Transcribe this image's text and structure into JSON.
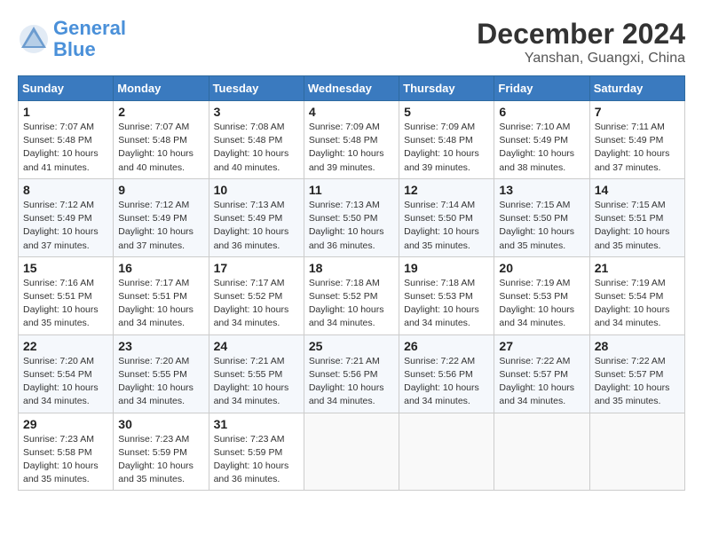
{
  "header": {
    "logo_line1": "General",
    "logo_line2": "Blue",
    "month": "December 2024",
    "location": "Yanshan, Guangxi, China"
  },
  "weekdays": [
    "Sunday",
    "Monday",
    "Tuesday",
    "Wednesday",
    "Thursday",
    "Friday",
    "Saturday"
  ],
  "weeks": [
    [
      {
        "day": "1",
        "info": "Sunrise: 7:07 AM\nSunset: 5:48 PM\nDaylight: 10 hours\nand 41 minutes."
      },
      {
        "day": "2",
        "info": "Sunrise: 7:07 AM\nSunset: 5:48 PM\nDaylight: 10 hours\nand 40 minutes."
      },
      {
        "day": "3",
        "info": "Sunrise: 7:08 AM\nSunset: 5:48 PM\nDaylight: 10 hours\nand 40 minutes."
      },
      {
        "day": "4",
        "info": "Sunrise: 7:09 AM\nSunset: 5:48 PM\nDaylight: 10 hours\nand 39 minutes."
      },
      {
        "day": "5",
        "info": "Sunrise: 7:09 AM\nSunset: 5:48 PM\nDaylight: 10 hours\nand 39 minutes."
      },
      {
        "day": "6",
        "info": "Sunrise: 7:10 AM\nSunset: 5:49 PM\nDaylight: 10 hours\nand 38 minutes."
      },
      {
        "day": "7",
        "info": "Sunrise: 7:11 AM\nSunset: 5:49 PM\nDaylight: 10 hours\nand 37 minutes."
      }
    ],
    [
      {
        "day": "8",
        "info": "Sunrise: 7:12 AM\nSunset: 5:49 PM\nDaylight: 10 hours\nand 37 minutes."
      },
      {
        "day": "9",
        "info": "Sunrise: 7:12 AM\nSunset: 5:49 PM\nDaylight: 10 hours\nand 37 minutes."
      },
      {
        "day": "10",
        "info": "Sunrise: 7:13 AM\nSunset: 5:49 PM\nDaylight: 10 hours\nand 36 minutes."
      },
      {
        "day": "11",
        "info": "Sunrise: 7:13 AM\nSunset: 5:50 PM\nDaylight: 10 hours\nand 36 minutes."
      },
      {
        "day": "12",
        "info": "Sunrise: 7:14 AM\nSunset: 5:50 PM\nDaylight: 10 hours\nand 35 minutes."
      },
      {
        "day": "13",
        "info": "Sunrise: 7:15 AM\nSunset: 5:50 PM\nDaylight: 10 hours\nand 35 minutes."
      },
      {
        "day": "14",
        "info": "Sunrise: 7:15 AM\nSunset: 5:51 PM\nDaylight: 10 hours\nand 35 minutes."
      }
    ],
    [
      {
        "day": "15",
        "info": "Sunrise: 7:16 AM\nSunset: 5:51 PM\nDaylight: 10 hours\nand 35 minutes."
      },
      {
        "day": "16",
        "info": "Sunrise: 7:17 AM\nSunset: 5:51 PM\nDaylight: 10 hours\nand 34 minutes."
      },
      {
        "day": "17",
        "info": "Sunrise: 7:17 AM\nSunset: 5:52 PM\nDaylight: 10 hours\nand 34 minutes."
      },
      {
        "day": "18",
        "info": "Sunrise: 7:18 AM\nSunset: 5:52 PM\nDaylight: 10 hours\nand 34 minutes."
      },
      {
        "day": "19",
        "info": "Sunrise: 7:18 AM\nSunset: 5:53 PM\nDaylight: 10 hours\nand 34 minutes."
      },
      {
        "day": "20",
        "info": "Sunrise: 7:19 AM\nSunset: 5:53 PM\nDaylight: 10 hours\nand 34 minutes."
      },
      {
        "day": "21",
        "info": "Sunrise: 7:19 AM\nSunset: 5:54 PM\nDaylight: 10 hours\nand 34 minutes."
      }
    ],
    [
      {
        "day": "22",
        "info": "Sunrise: 7:20 AM\nSunset: 5:54 PM\nDaylight: 10 hours\nand 34 minutes."
      },
      {
        "day": "23",
        "info": "Sunrise: 7:20 AM\nSunset: 5:55 PM\nDaylight: 10 hours\nand 34 minutes."
      },
      {
        "day": "24",
        "info": "Sunrise: 7:21 AM\nSunset: 5:55 PM\nDaylight: 10 hours\nand 34 minutes."
      },
      {
        "day": "25",
        "info": "Sunrise: 7:21 AM\nSunset: 5:56 PM\nDaylight: 10 hours\nand 34 minutes."
      },
      {
        "day": "26",
        "info": "Sunrise: 7:22 AM\nSunset: 5:56 PM\nDaylight: 10 hours\nand 34 minutes."
      },
      {
        "day": "27",
        "info": "Sunrise: 7:22 AM\nSunset: 5:57 PM\nDaylight: 10 hours\nand 34 minutes."
      },
      {
        "day": "28",
        "info": "Sunrise: 7:22 AM\nSunset: 5:57 PM\nDaylight: 10 hours\nand 35 minutes."
      }
    ],
    [
      {
        "day": "29",
        "info": "Sunrise: 7:23 AM\nSunset: 5:58 PM\nDaylight: 10 hours\nand 35 minutes."
      },
      {
        "day": "30",
        "info": "Sunrise: 7:23 AM\nSunset: 5:59 PM\nDaylight: 10 hours\nand 35 minutes."
      },
      {
        "day": "31",
        "info": "Sunrise: 7:23 AM\nSunset: 5:59 PM\nDaylight: 10 hours\nand 36 minutes."
      },
      null,
      null,
      null,
      null
    ]
  ]
}
